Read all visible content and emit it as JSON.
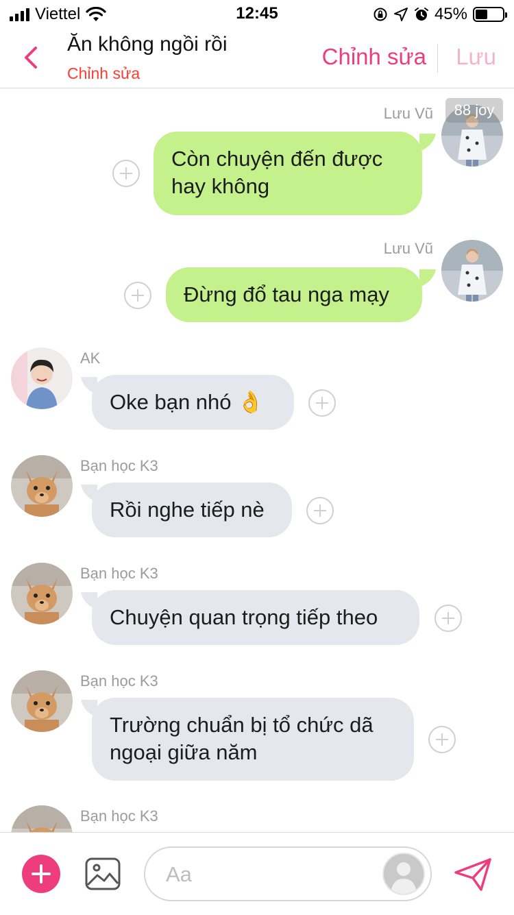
{
  "status_bar": {
    "carrier": "Viettel",
    "time": "12:45",
    "battery": "45%",
    "battery_level": 0.45
  },
  "header": {
    "title": "Ăn không ngồi rồi",
    "subtitle": "Chỉnh sửa",
    "edit_label": "Chỉnh sửa",
    "save_label": "Lưu",
    "colors": {
      "accent": "#ee3d7d",
      "accent_disabled": "#f5b3cb",
      "subtitle": "#ff3b30"
    }
  },
  "watermark": "88 joy",
  "messages": [
    {
      "sender": "Lưu Vũ",
      "text": "Còn chuyện đến được\nhay không",
      "direction": "outgoing",
      "avatar": "person-avatar"
    },
    {
      "sender": "Lưu Vũ",
      "text": "Đừng đổ tau nga mạy",
      "direction": "outgoing",
      "avatar": "person-avatar"
    },
    {
      "sender": "AK",
      "text": "Oke bạn nhó 👌",
      "direction": "incoming",
      "avatar": "person-avatar"
    },
    {
      "sender": "Bạn học K3",
      "text": "Rồi nghe tiếp nè",
      "direction": "incoming",
      "avatar": "dog-avatar"
    },
    {
      "sender": "Bạn học K3",
      "text": "Chuyện quan trọng tiếp theo",
      "direction": "incoming",
      "avatar": "dog-avatar"
    },
    {
      "sender": "Bạn học K3",
      "text": "Trường chuẩn bị tổ chức dã\nngoại giữa năm",
      "direction": "incoming",
      "avatar": "dog-avatar"
    },
    {
      "sender": "Bạn học K3",
      "text": "",
      "direction": "incoming",
      "avatar": "dog-avatar"
    }
  ],
  "colors": {
    "outgoing_bubble": "#c4f18b",
    "incoming_bubble": "#e4e7eb"
  },
  "composer": {
    "placeholder": "Aa",
    "icons": [
      "plus-icon",
      "image-icon",
      "send-icon"
    ]
  }
}
